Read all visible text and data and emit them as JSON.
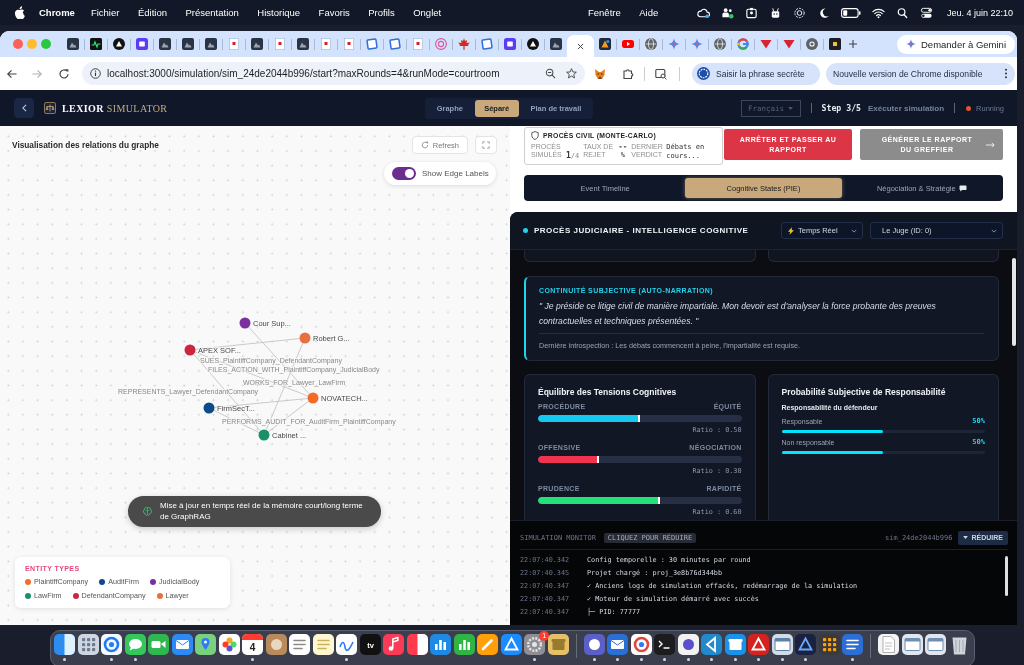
{
  "menu_bar": {
    "app_name": "Chrome",
    "menus": [
      "Fichier",
      "Édition",
      "Présentation",
      "Historique",
      "Favoris",
      "Profils",
      "Onglet"
    ],
    "more_menus": [
      "Fenêtre",
      "Aide"
    ],
    "clock": "Jeu. 4 juin 22:10"
  },
  "browser": {
    "tabs": [
      {
        "kind": "dark-app",
        "selected": false
      },
      {
        "kind": "pulse",
        "selected": false
      },
      {
        "kind": "triangle-circle",
        "selected": false
      },
      {
        "kind": "purple-square",
        "selected": false
      },
      {
        "kind": "dark-app",
        "selected": false
      },
      {
        "kind": "dark-app",
        "selected": false
      },
      {
        "kind": "dark-app",
        "selected": false
      },
      {
        "kind": "document",
        "selected": false
      },
      {
        "kind": "dark-app",
        "selected": false
      },
      {
        "kind": "document",
        "selected": false
      },
      {
        "kind": "dark-app",
        "selected": false
      },
      {
        "kind": "document",
        "selected": false
      },
      {
        "kind": "document",
        "selected": false
      },
      {
        "kind": "frame",
        "selected": false
      },
      {
        "kind": "frame",
        "selected": false
      },
      {
        "kind": "document",
        "selected": false
      },
      {
        "kind": "target",
        "selected": false
      },
      {
        "kind": "maple-leaf",
        "selected": false
      },
      {
        "kind": "frame",
        "selected": false
      },
      {
        "kind": "purple-square",
        "selected": false
      },
      {
        "kind": "triangle-circle",
        "selected": false
      },
      {
        "kind": "dark-app",
        "selected": false
      },
      {
        "selected": true
      },
      {
        "kind": "orange-tile",
        "selected": false
      },
      {
        "kind": "play",
        "selected": false
      },
      {
        "kind": "globe",
        "selected": false
      },
      {
        "kind": "sparkle",
        "selected": false
      },
      {
        "kind": "sparkle",
        "selected": false
      },
      {
        "kind": "globe",
        "selected": false
      },
      {
        "kind": "ring",
        "selected": false
      },
      {
        "kind": "red-triangle",
        "selected": false
      },
      {
        "kind": "red-triangle",
        "selected": false
      },
      {
        "kind": "aperture",
        "selected": false
      },
      {
        "kind": "dark-square",
        "selected": false
      }
    ],
    "ask_button": "Demander à Gemini",
    "url": "localhost:3000/simulation/sim_24de2044b996/start?maxRounds=4&runMode=courtroom",
    "secret_phrase_button": "Saisir la phrase secrète",
    "update_button": "Nouvelle version de Chrome disponible"
  },
  "app_header": {
    "brand_name": "LEXIOR",
    "brand_product": "SIMULATOR",
    "view_modes": [
      {
        "label": "Graphe",
        "selected": false
      },
      {
        "label": "Séparé",
        "selected": true
      },
      {
        "label": "Plan de travail",
        "selected": false
      }
    ],
    "language_select": "Français",
    "step": "Step 3/5",
    "step_name": "Exécuter simulation",
    "status": "Running"
  },
  "graph_panel": {
    "title": "Visualisation des relations du graphe",
    "refresh_button": "Refresh",
    "edge_labels_toggle": {
      "label": "Show Edge Labels",
      "on": true
    },
    "nodes": [
      {
        "label": "Cour Sup...",
        "color": "#7b2f9e"
      },
      {
        "label": "Robert G...",
        "color": "#e8703f"
      },
      {
        "label": "APEX SOF...",
        "color": "#c92640"
      },
      {
        "label": "NOVATECH...",
        "color": "#f56a26"
      },
      {
        "label": "FirmSecT...",
        "color": "#0b4a8b"
      },
      {
        "label": "Cabinet ...",
        "color": "#1b9068"
      }
    ],
    "edges": [
      {
        "label": "SUES_PlaintiffCompany_DefendantCompany"
      },
      {
        "label": "FILES_ACTION_WITH_PlaintiffCompany_JudicialBody"
      },
      {
        "label": "WORKS_FOR_Lawyer_LawFirm"
      },
      {
        "label": "REPRESENTS_Lawyer_DefendantCompany"
      },
      {
        "label": "PERFORMS_AUDIT_FOR_AuditFirm_PlaintiffCompany"
      }
    ],
    "toast": "Mise à jour en temps réel de la mémoire court/long terme de GraphRAG",
    "legend": {
      "title": "ENTITY TYPES",
      "items": [
        {
          "label": "PlaintiffCompany",
          "color": "#f26d2d"
        },
        {
          "label": "AuditFirm",
          "color": "#0b4a8b"
        },
        {
          "label": "JudicialBody",
          "color": "#7b2f9e"
        },
        {
          "label": "LawFirm",
          "color": "#1b9068"
        },
        {
          "label": "DefendantCompany",
          "color": "#c92640"
        },
        {
          "label": "Lawyer",
          "color": "#e8703f"
        }
      ]
    }
  },
  "case_summary": {
    "title": "PROCÈS CIVIL (MONTE-CARLO)",
    "stats": [
      {
        "kind": "fraction",
        "label": "PROCÈS SIMULÉS",
        "value": "1",
        "total": "/4"
      },
      {
        "kind": "percent",
        "label": "TAUX DE REJET",
        "value": "--",
        "unit": "%"
      },
      {
        "kind": "text",
        "label": "DERNIER VERDICT",
        "value": "Débats en cours..."
      }
    ]
  },
  "actions": [
    {
      "kind": "danger",
      "label": "ARRÊTER ET PASSER AU RAPPORT",
      "disabled": false
    },
    {
      "kind": "next",
      "label": "GÉNÉRER LE RAPPORT DU GREFFIER",
      "disabled": true
    }
  ],
  "panel_tabs": [
    {
      "kind": "text",
      "label": "Event Timeline",
      "selected": false
    },
    {
      "kind": "text",
      "label": "Cognitive States (PIE)",
      "selected": true
    },
    {
      "kind": "chat",
      "label": "Négociation & Stratégie",
      "selected": false
    }
  ],
  "cognitive_panel": {
    "title": "PROCÈS JUDICIAIRE - INTELLIGENCE COGNITIVE",
    "mode_select": "Temps Réel",
    "agent_select": "Le Juge (ID: 0)",
    "narration": {
      "heading": "CONTINUITÉ SUBJECTIVE (AUTO-NARRATION)",
      "quote": "\" Je préside ce litige civil de manière impartiale. Mon devoir est d'analyser la force probante des preuves contractuelles et techniques présentées. \"",
      "last_introspection": "Dernière introspection : Les débats commencent à peine, l'impartialité est requise."
    },
    "tensions": {
      "title": "Équilibre des Tensions Cognitives",
      "axes": [
        {
          "left": "PROCÉDURE",
          "right": "ÉQUITÉ",
          "level": 0.5,
          "ratio": "Ratio : 0.50",
          "color": "#14c8f0"
        },
        {
          "left": "OFFENSIVE",
          "right": "NÉGOCIATION",
          "level": 0.3,
          "ratio": "Ratio : 0.30",
          "color": "#f0344f"
        },
        {
          "left": "PRUDENCE",
          "right": "RAPIDITÉ",
          "level": 0.6,
          "ratio": "Ratio : 0.60",
          "color": "#22e07a"
        }
      ]
    },
    "responsibility": {
      "title": "Probabilité Subjective de Responsabilité",
      "subtitle": "Responsabilité du défendeur",
      "rows": [
        {
          "label": "Responsable",
          "value": "50%",
          "level": 0.5
        },
        {
          "label": "Non responsable",
          "value": "50%",
          "level": 0.5
        }
      ]
    }
  },
  "simulation_monitor": {
    "title": "SIMULATION MONITOR",
    "hint": "CLIQUEZ POUR RÉDUIRE",
    "sim_id": "sim_24de2044b996",
    "collapse_button": "RÉDUIRE",
    "logs": [
      {
        "time": "22:07:40.342",
        "message": "Config temporelle : 30 minutes par round"
      },
      {
        "time": "22:07:40.345",
        "message": "Projet chargé : proj_3e8b76d344bb"
      },
      {
        "time": "22:07:40.347",
        "message": "✓ Anciens logs de simulation effacés, redémarrage de la simulation"
      },
      {
        "time": "22:07:40.347",
        "message": "✓ Moteur de simulation démarré avec succès"
      },
      {
        "time": "22:07:40.347",
        "message": "├─ PID: 77777"
      }
    ]
  },
  "dock": {
    "apps": [
      {
        "kind": "finder",
        "running": true
      },
      {
        "kind": "launchpad",
        "running": false
      },
      {
        "kind": "safari",
        "running": true
      },
      {
        "kind": "messages",
        "running": true
      },
      {
        "kind": "facetime",
        "running": false
      },
      {
        "kind": "mail",
        "running": false
      },
      {
        "kind": "maps",
        "running": false
      },
      {
        "kind": "photos",
        "running": false
      },
      {
        "kind": "calendar",
        "day": "4",
        "running": true
      },
      {
        "kind": "contacts",
        "running": false
      },
      {
        "kind": "reminders",
        "running": false
      },
      {
        "kind": "notes",
        "running": false
      },
      {
        "kind": "freeform",
        "running": true
      },
      {
        "kind": "tv",
        "label": "tv",
        "running": false
      },
      {
        "kind": "music",
        "running": false
      },
      {
        "kind": "news",
        "running": false
      },
      {
        "kind": "keynote",
        "running": false
      },
      {
        "kind": "numbers",
        "running": false
      },
      {
        "kind": "pages",
        "running": false
      },
      {
        "kind": "appstore",
        "running": false
      },
      {
        "kind": "settings",
        "badge": "1",
        "running": true
      },
      {
        "kind": "archive",
        "running": false
      }
    ],
    "more_apps": [
      {
        "kind": "teams",
        "running": true
      },
      {
        "kind": "outlook",
        "running": true
      },
      {
        "kind": "chrome",
        "running": true
      },
      {
        "kind": "terminal",
        "running": true
      },
      {
        "kind": "scrivener",
        "running": true
      },
      {
        "kind": "vscode",
        "running": true
      },
      {
        "kind": "docker",
        "running": true
      },
      {
        "kind": "acrobat",
        "running": true
      },
      {
        "kind": "preview",
        "running": true
      },
      {
        "kind": "arc",
        "running": true
      },
      {
        "kind": "calculator",
        "running": false
      },
      {
        "kind": "word",
        "running": true
      }
    ],
    "stacks": [
      {
        "kind": "document",
        "running": false
      },
      {
        "kind": "screenshots",
        "running": false
      },
      {
        "kind": "screenshots",
        "running": false
      },
      {
        "kind": "trash",
        "running": false
      }
    ]
  }
}
